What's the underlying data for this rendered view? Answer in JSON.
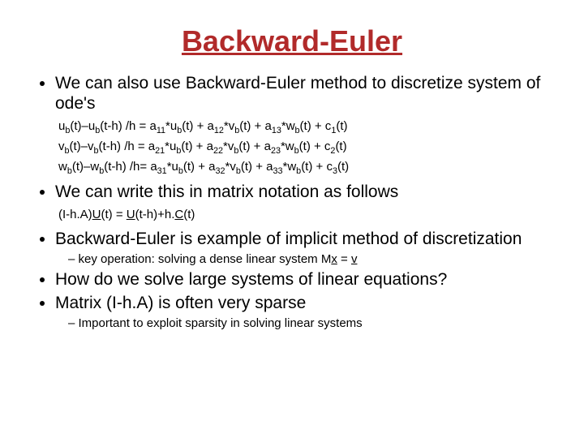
{
  "title": "Backward-Euler",
  "bullets": {
    "b1": "We can also use Backward-Euler method to discretize system of ode's",
    "eq1_pre": "u",
    "eq1_s1": "b",
    "eq1_a": "(t)–u",
    "eq1_s2": "b",
    "eq1_b": "(t-h) /h = a",
    "eq1_s3": "11",
    "eq1_c": "*u",
    "eq1_s4": "b",
    "eq1_d": "(t) + a",
    "eq1_s5": "12",
    "eq1_e": "*v",
    "eq1_s6": "b",
    "eq1_f": "(t) + a",
    "eq1_s7": "13",
    "eq1_g": "*w",
    "eq1_s8": "b",
    "eq1_h": "(t) + c",
    "eq1_s9": "1",
    "eq1_i": "(t)",
    "eq2_pre": "v",
    "eq2_s1": "b",
    "eq2_a": "(t)–v",
    "eq2_s2": "b",
    "eq2_b": "(t-h) /h = a",
    "eq2_s3": "21",
    "eq2_c": "*u",
    "eq2_s4": "b",
    "eq2_d": "(t) + a",
    "eq2_s5": "22",
    "eq2_e": "*v",
    "eq2_s6": "b",
    "eq2_f": "(t) + a",
    "eq2_s7": "23",
    "eq2_g": "*w",
    "eq2_s8": "b",
    "eq2_h": "(t) + c",
    "eq2_s9": "2",
    "eq2_i": "(t)",
    "eq3_pre": "w",
    "eq3_s1": "b",
    "eq3_a": "(t)–w",
    "eq3_s2": "b",
    "eq3_b": "(t-h) /h= a",
    "eq3_s3": "31",
    "eq3_c": "*u",
    "eq3_s4": "b",
    "eq3_d": "(t) + a",
    "eq3_s5": "32",
    "eq3_e": "*v",
    "eq3_s6": "b",
    "eq3_f": "(t) + a",
    "eq3_s7": "33",
    "eq3_g": "*w",
    "eq3_s8": "b",
    "eq3_h": "(t) + c",
    "eq3_s9": "3",
    "eq3_i": "(t)",
    "b2": "We can write this in matrix notation as follows",
    "m_a": "(I-h.A)",
    "m_U1": "U",
    "m_b": "(t) = ",
    "m_U2": "U",
    "m_c": "(t-h)+h.",
    "m_C": "C",
    "m_d": "(t)",
    "b3": "Backward-Euler is example of implicit method of discretization",
    "d1_a": "key operation: solving a dense linear system M",
    "d1_x": "x",
    "d1_b": " = ",
    "d1_v": "v",
    "b4": "How do we solve large systems of linear equations?",
    "b5": "Matrix (I-h.A) is often very sparse",
    "d2": "Important to exploit sparsity in solving linear systems"
  }
}
